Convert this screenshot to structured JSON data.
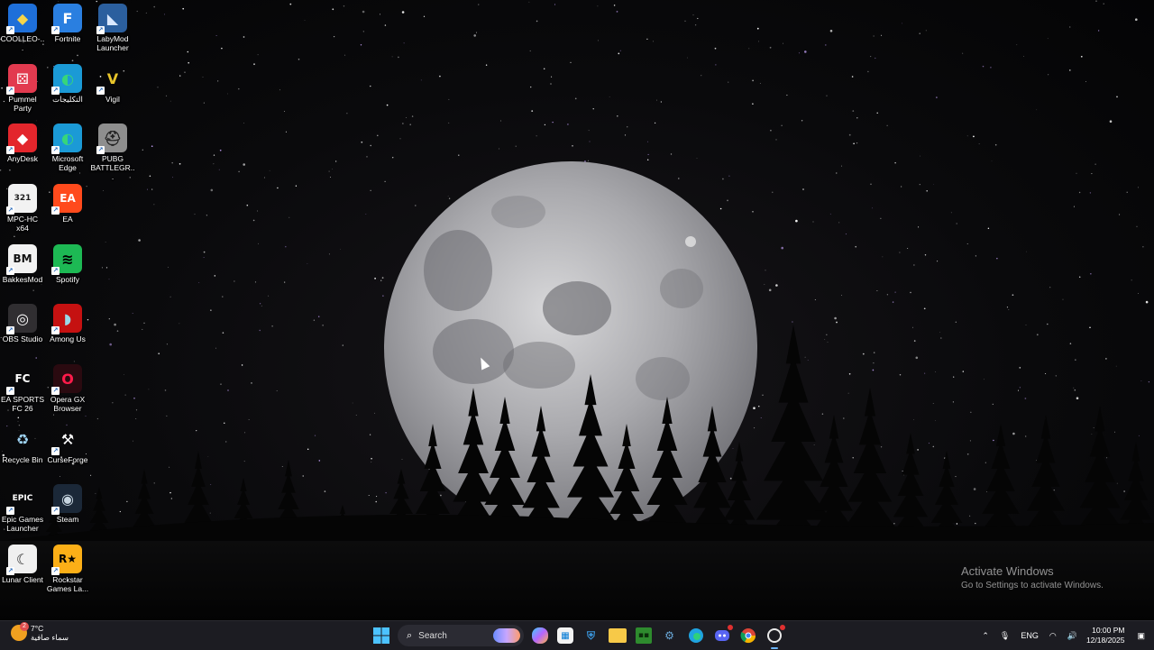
{
  "desktop": {
    "icons": [
      {
        "label": "COOLLEO-...",
        "icon": "coolleo-icon"
      },
      {
        "label": "Fortnite",
        "icon": "fortnite-icon"
      },
      {
        "label": "LabyMod Launcher",
        "icon": "labymod-icon"
      },
      {
        "label": "Pummel Party",
        "icon": "pummel-party-icon"
      },
      {
        "label": "التكليجات",
        "icon": "edge-icon"
      },
      {
        "label": "Vigil",
        "icon": "vigil-icon"
      },
      {
        "label": "AnyDesk",
        "icon": "anydesk-icon"
      },
      {
        "label": "Microsoft Edge",
        "icon": "edge-icon"
      },
      {
        "label": "PUBG BATTLEGR...",
        "icon": "pubg-icon"
      },
      {
        "label": "MPC-HC x64",
        "icon": "mpc-hc-icon"
      },
      {
        "label": "EA",
        "icon": "ea-icon"
      },
      {
        "label": "BakkesMod",
        "icon": "bakkesmod-icon"
      },
      {
        "label": "Spotify",
        "icon": "spotify-icon"
      },
      {
        "label": "OBS Studio",
        "icon": "obs-icon"
      },
      {
        "label": "Among Us",
        "icon": "among-us-icon"
      },
      {
        "label": "EA SPORTS FC 26",
        "icon": "fc26-icon"
      },
      {
        "label": "Opera GX Browser",
        "icon": "opera-gx-icon"
      },
      {
        "label": "Recycle Bin",
        "icon": "recycle-bin-icon"
      },
      {
        "label": "CurseForge",
        "icon": "curseforge-icon"
      },
      {
        "label": "Epic Games Launcher",
        "icon": "epic-games-icon"
      },
      {
        "label": "Steam",
        "icon": "steam-icon"
      },
      {
        "label": "Lunar Client",
        "icon": "lunar-client-icon"
      },
      {
        "label": "Rockstar Games La...",
        "icon": "rockstar-icon"
      }
    ],
    "watermark": {
      "title": "Activate Windows",
      "subtitle": "Go to Settings to activate Windows."
    }
  },
  "taskbar": {
    "weather": {
      "temp": "7°C",
      "condition": "سماء صافية",
      "badge": "2"
    },
    "search": {
      "placeholder": "Search"
    },
    "pinned": [
      {
        "name": "start-button",
        "icon": "windows-icon"
      },
      {
        "name": "copilot-button",
        "icon": "copilot-icon"
      },
      {
        "name": "store-button",
        "icon": "store-icon"
      },
      {
        "name": "defender-button",
        "icon": "shield-icon"
      },
      {
        "name": "file-explorer-button",
        "icon": "folder-icon"
      },
      {
        "name": "minecraft-button",
        "icon": "minecraft-icon"
      },
      {
        "name": "app-button",
        "icon": "gear-icon"
      },
      {
        "name": "edge-button",
        "icon": "edge-icon"
      },
      {
        "name": "discord-button",
        "icon": "discord-icon"
      },
      {
        "name": "chrome-button",
        "icon": "chrome-icon"
      },
      {
        "name": "opera-button",
        "icon": "opera-gx-icon"
      }
    ],
    "tray": {
      "language": "ENG",
      "time": "10:00 PM",
      "date": "12/18/2025"
    }
  },
  "colors": {
    "taskbar_bg": "#1c1c22",
    "accent": "#6cb6ff"
  }
}
